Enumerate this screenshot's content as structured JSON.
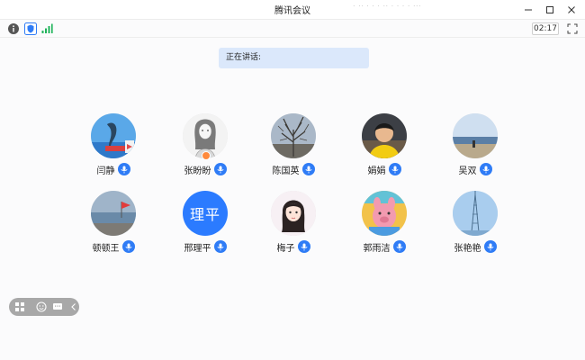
{
  "window": {
    "title": "腾讯会议",
    "edge_text": "  .  ..  .  .  .  ..  . .  . . ..."
  },
  "toolbar": {
    "timer": "02:17",
    "icons": [
      "info-icon",
      "shield-icon",
      "signal-icon",
      "fullscreen-icon"
    ]
  },
  "speaking": {
    "label": "正在讲话:"
  },
  "participants": [
    {
      "name": "闫静",
      "avatar": "photo-dolphin"
    },
    {
      "name": "张盼盼",
      "avatar": "photo-sketch-girl",
      "host": true
    },
    {
      "name": "陈国英",
      "avatar": "photo-tree"
    },
    {
      "name": "娟娟",
      "avatar": "photo-child-yellow"
    },
    {
      "name": "吴双",
      "avatar": "photo-beach"
    },
    {
      "name": "顿顿王",
      "avatar": "photo-coast-flag"
    },
    {
      "name": "邢理平",
      "avatar": "text",
      "avatar_text": "理平"
    },
    {
      "name": "梅子",
      "avatar": "photo-anime-girl"
    },
    {
      "name": "郭雨洁",
      "avatar": "photo-cartoon-pig"
    },
    {
      "name": "张艳艳",
      "avatar": "photo-tower"
    }
  ],
  "colors": {
    "accent": "#2f7cf6",
    "speaking_bg": "#dbe8fb",
    "text_avatar_bg": "#2b7bff"
  }
}
